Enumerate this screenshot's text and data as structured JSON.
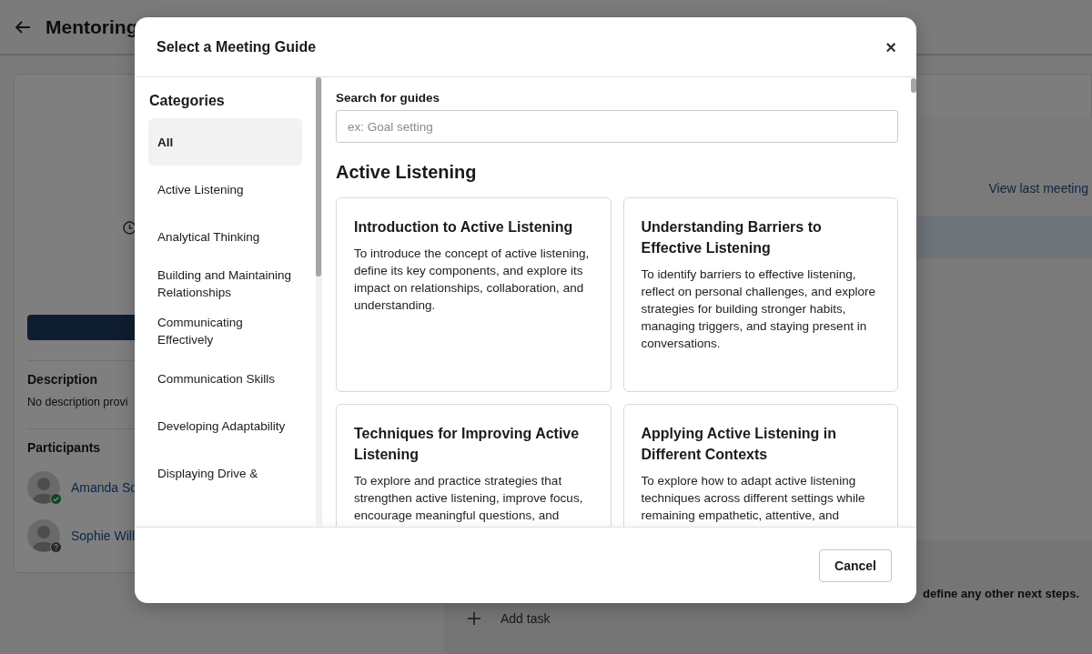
{
  "page": {
    "title": "Mentoring",
    "description_label": "Description",
    "description": "No description provi",
    "participants_label": "Participants",
    "participants": [
      {
        "name": "Amanda Sc",
        "kind": "accepted"
      },
      {
        "name": "Sophie Will",
        "kind": "pending"
      }
    ],
    "view_last_meeting": "View last meeting",
    "next_steps_text": "define any other next steps.",
    "add_task": "Add task"
  },
  "modal": {
    "title": "Select a Meeting Guide",
    "close": "×",
    "categories_title": "Categories",
    "categories": [
      {
        "label": "All",
        "selected": true
      },
      {
        "label": "Active Listening",
        "selected": false
      },
      {
        "label": "Analytical Thinking",
        "selected": false
      },
      {
        "label": "Building and Maintaining Relationships",
        "selected": false
      },
      {
        "label": "Communicating Effectively",
        "selected": false
      },
      {
        "label": "Communication Skills",
        "selected": false
      },
      {
        "label": "Developing Adaptability",
        "selected": false
      },
      {
        "label": "Displaying Drive &",
        "selected": false
      }
    ],
    "search": {
      "label": "Search for guides",
      "placeholder": "ex: Goal setting"
    },
    "section_title": "Active Listening",
    "guides": [
      {
        "title": "Introduction to Active Listening",
        "description": "To introduce the concept of active listening, define its key components, and explore its impact on relationships, collaboration, and understanding."
      },
      {
        "title": "Understanding Barriers to Effective Listening",
        "description": "To identify barriers to effective listening, reflect on personal challenges, and explore strategies for building stronger habits, managing triggers, and staying present in conversations."
      },
      {
        "title": "Techniques for Improving Active Listening",
        "description": "To explore and practice strategies that strengthen active listening, improve focus, encourage meaningful questions, and"
      },
      {
        "title": "Applying Active Listening in Different Contexts",
        "description": "To explore how to adapt active listening techniques across different settings while remaining empathetic, attentive, and"
      }
    ],
    "buttons": [
      "Cancel"
    ]
  }
}
